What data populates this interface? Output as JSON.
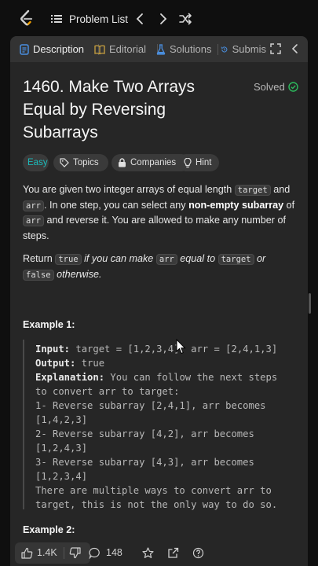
{
  "topbar": {
    "problem_list_label": "Problem List",
    "icons": [
      "leetcode-logo",
      "list-icon",
      "chevron-left-icon",
      "chevron-right-icon",
      "shuffle-icon"
    ]
  },
  "tabs": [
    {
      "label": "Description",
      "icon": "description-icon",
      "active": true
    },
    {
      "label": "Editorial",
      "icon": "book-icon",
      "active": false
    },
    {
      "label": "Solutions",
      "icon": "flask-icon",
      "active": false
    },
    {
      "label": "Submis",
      "icon": "history-icon",
      "active": false
    }
  ],
  "problem": {
    "title": "1460. Make Two Arrays Equal by Reversing Subarrays",
    "status": "Solved",
    "difficulty": "Easy",
    "chips": [
      "Topics",
      "Companies",
      "Hint"
    ]
  },
  "description": {
    "p1_a": "You are given two integer arrays of equal length",
    "code_target": "target",
    "p1_and": "and",
    "code_arr": "arr",
    "p1_b": ". In one step, you can select any",
    "p1_bold": "non-empty subarray",
    "p1_of": "of",
    "p1_c": "and reverse it. You are allowed to make any number of steps.",
    "p2_return": "Return",
    "code_true": "true",
    "p2_if": "if you can make",
    "p2_equal": "equal to",
    "p2_or": "or",
    "code_false": "false",
    "p2_otherwise": "otherwise."
  },
  "example1": {
    "title": "Example 1:",
    "input_label": "Input:",
    "input_value": " target = [1,2,3,4], arr = [2,4,1,3]",
    "output_label": "Output:",
    "output_value": " true",
    "explanation_label": "Explanation:",
    "explanation_value": " You can follow the next steps",
    "lines": [
      "to convert arr to target:",
      "1- Reverse subarray [2,4,1], arr becomes",
      "[1,4,2,3]",
      "2- Reverse subarray [4,2], arr becomes",
      "[1,2,4,3]",
      "3- Reverse subarray [4,3], arr becomes",
      "[1,2,3,4]",
      "There are multiple ways to convert arr to",
      "target, this is not the only way to do so."
    ]
  },
  "example2": {
    "title": "Example 2:"
  },
  "bottombar": {
    "likes": "1.4K",
    "comments": "148"
  },
  "colors": {
    "easy": "#1cbaba",
    "solved_check": "#2cbb5d",
    "panel": "#262626",
    "tabbar": "#333333"
  }
}
